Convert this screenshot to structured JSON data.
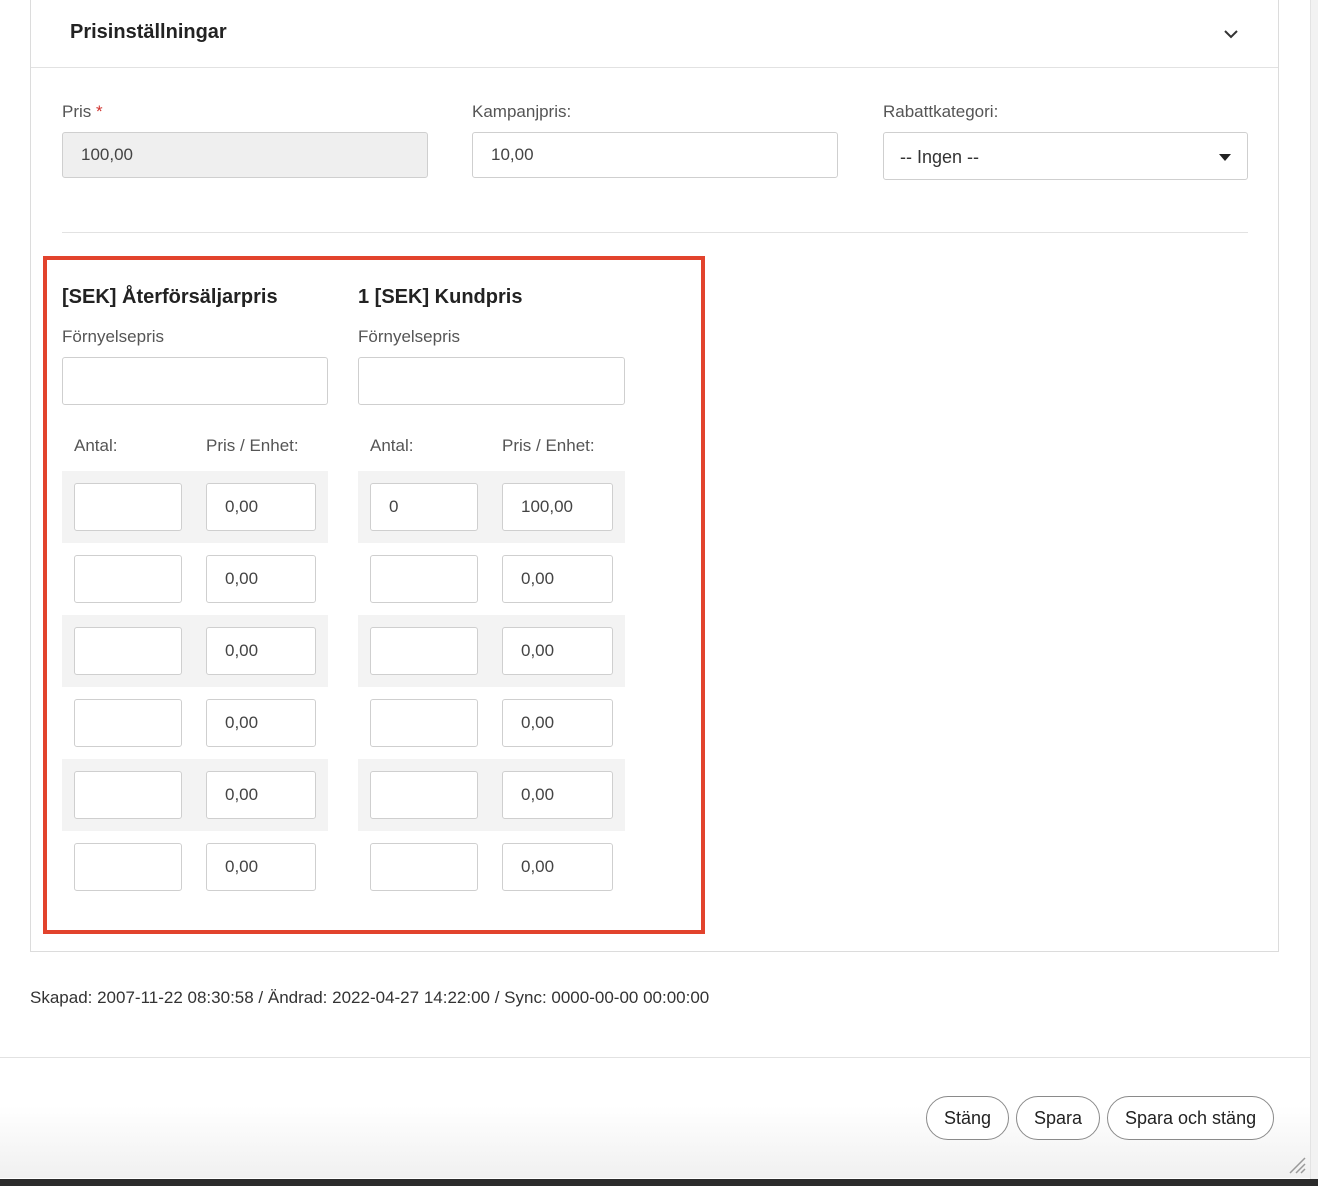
{
  "section": {
    "title": "Prisinställningar",
    "toggle_icon": "chevron-down-icon"
  },
  "price_fields": {
    "pris": {
      "label": "Pris",
      "required_mark": "*",
      "value": "100,00"
    },
    "kampanjpris": {
      "label": "Kampanjpris:",
      "value": "10,00"
    },
    "rabattkategori": {
      "label": "Rabattkategori:",
      "selected": "-- Ingen --"
    }
  },
  "price_lists": [
    {
      "title": "[SEK] Återförsäljarpris",
      "renewal_label": "Förnyelsepris",
      "renewal_value": "",
      "qty_header": "Antal:",
      "unit_header": "Pris / Enhet:",
      "rows": [
        {
          "qty": "",
          "price": "0,00"
        },
        {
          "qty": "",
          "price": "0,00"
        },
        {
          "qty": "",
          "price": "0,00"
        },
        {
          "qty": "",
          "price": "0,00"
        },
        {
          "qty": "",
          "price": "0,00"
        },
        {
          "qty": "",
          "price": "0,00"
        }
      ]
    },
    {
      "title": "1 [SEK] Kundpris",
      "renewal_label": "Förnyelsepris",
      "renewal_value": "",
      "qty_header": "Antal:",
      "unit_header": "Pris / Enhet:",
      "rows": [
        {
          "qty": "0",
          "price": "100,00"
        },
        {
          "qty": "",
          "price": "0,00"
        },
        {
          "qty": "",
          "price": "0,00"
        },
        {
          "qty": "",
          "price": "0,00"
        },
        {
          "qty": "",
          "price": "0,00"
        },
        {
          "qty": "",
          "price": "0,00"
        }
      ]
    }
  ],
  "meta": {
    "text": "Skapad: 2007-11-22 08:30:58 / Ändrad: 2022-04-27 14:22:00 / Sync: 0000-00-00 00:00:00"
  },
  "footer": {
    "close_label": "Stäng",
    "save_label": "Spara",
    "save_close_label": "Spara och stäng"
  },
  "colors": {
    "highlight": "#e2432d",
    "required": "#d0312d"
  }
}
